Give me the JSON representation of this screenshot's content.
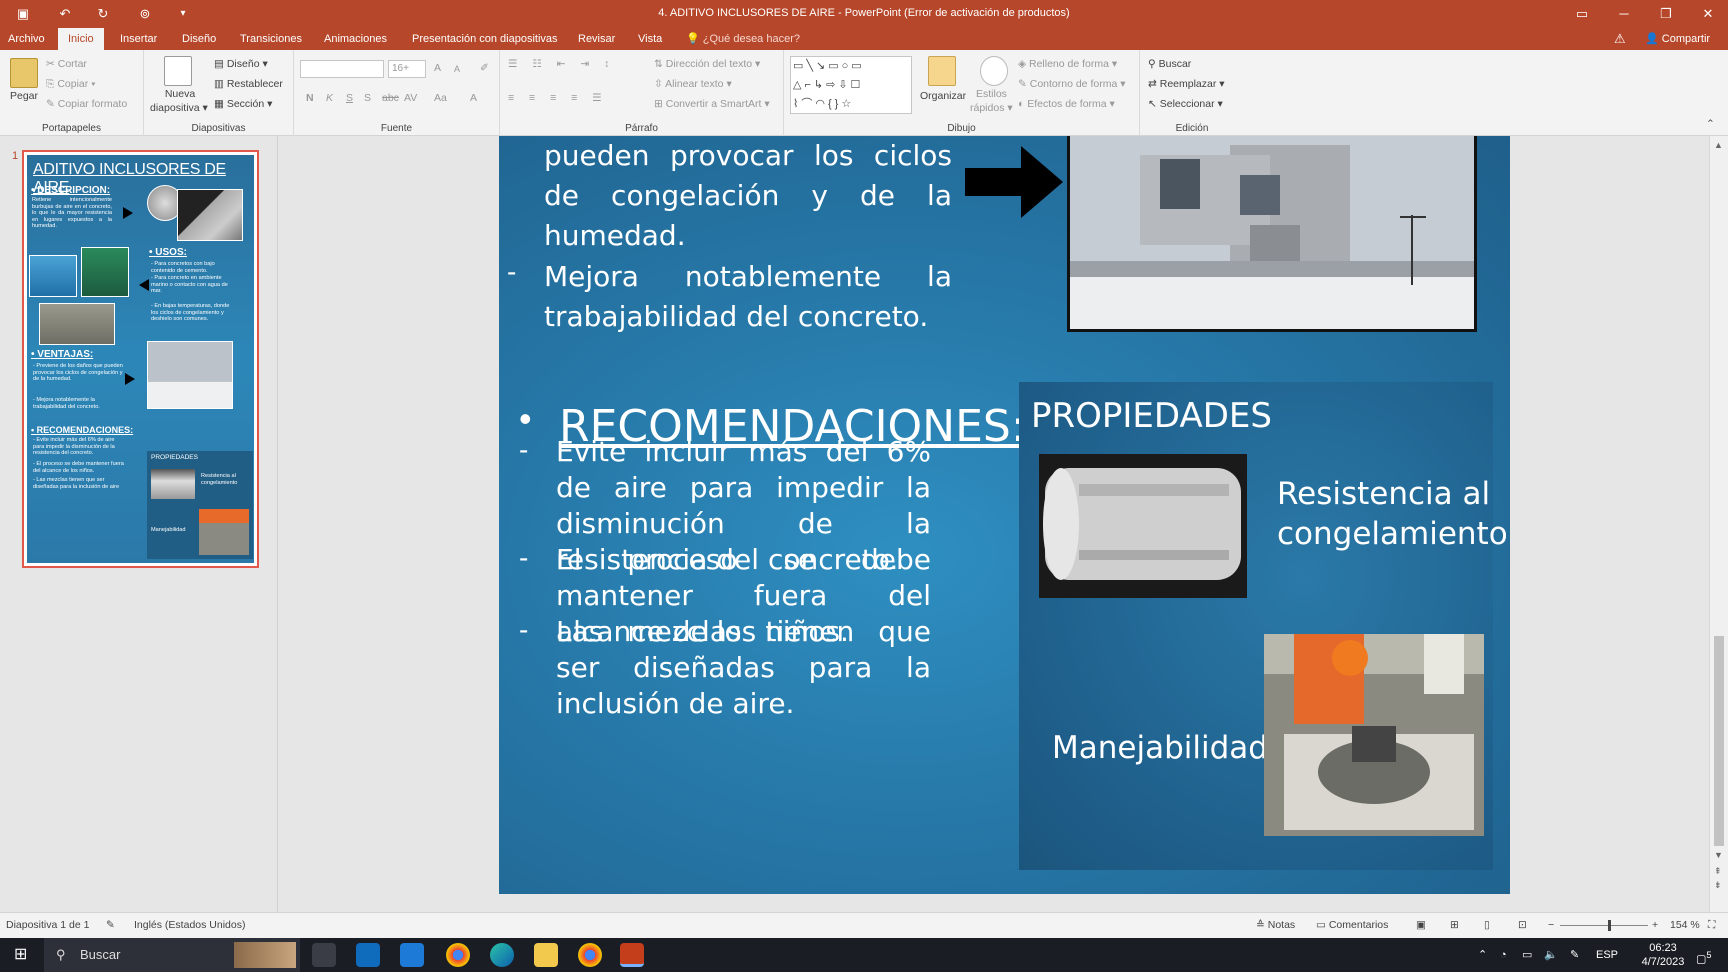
{
  "window": {
    "title": "4. ADITIVO INCLUSORES DE AIRE - PowerPoint (Error de activación de productos)",
    "share_label": "Compartir",
    "tellme_placeholder": "¿Qué desea hacer?"
  },
  "tabs": [
    "Archivo",
    "Inicio",
    "Insertar",
    "Diseño",
    "Transiciones",
    "Animaciones",
    "Presentación con diapositivas",
    "Revisar",
    "Vista"
  ],
  "ribbon": {
    "portapapeles": {
      "label": "Portapapeles",
      "paste": "Pegar",
      "cut": "Cortar",
      "copy": "Copiar",
      "format_painter": "Copiar formato"
    },
    "diapositivas": {
      "label": "Diapositivas",
      "new_slide_1": "Nueva",
      "new_slide_2": "diapositiva",
      "layout": "Diseño",
      "reset": "Restablecer",
      "section": "Sección"
    },
    "fuente": {
      "label": "Fuente",
      "font_size": "16+",
      "bold": "N",
      "italic": "K",
      "underline": "S",
      "shadow": "S",
      "strike": "abc",
      "spacing": "AV",
      "case": "Aa",
      "grow": "A",
      "shrink": "A",
      "color": "A"
    },
    "parrafo": {
      "label": "Párrafo",
      "text_direction": "Dirección del texto",
      "align_text": "Alinear texto",
      "smartart": "Convertir a SmartArt"
    },
    "dibujo": {
      "label": "Dibujo",
      "arrange": "Organizar",
      "styles_1": "Estilos",
      "styles_2": "rápidos",
      "fill": "Relleno de forma",
      "outline": "Contorno de forma",
      "effects": "Efectos de forma"
    },
    "edicion": {
      "label": "Edición",
      "find": "Buscar",
      "replace": "Reemplazar",
      "select": "Seleccionar"
    }
  },
  "thumbnail": {
    "number": "1",
    "title": "ADITIVO INCLUSORES DE AIRE",
    "descripcion_h": "DESCRIPCION:",
    "descripcion": "Retiene intencionalmente burbujas de aire en el concreto, lo que le da mayor resistencia en lugares expuestos a la humedad.",
    "usos_h": "USOS:",
    "usos": [
      "Para concretos con bajo contenido de cemento.",
      "Para concreto en ambiente marino o contacto con agua de mar.",
      "En bajas temperaturas, donde los ciclos de congelamiento y deshielo son comunes."
    ],
    "ventajas_h": "VENTAJAS:",
    "ventajas": [
      "Previene de los daños que pueden provocar los ciclos de congelación y de la humedad.",
      "Mejora notablemente la trabajabilidad del concreto."
    ],
    "reco_h": "RECOMENDACIONES:",
    "reco": [
      "Evite incluir más del 6% de aire para impedir la disminución de la resistencia del concreto.",
      "El proceso se debe mantener fuera del alcance de los niños.",
      "Las mezclas tienen que ser diseñadas para la inclusión de aire"
    ],
    "prop_h": "PROPIEDADES",
    "prop_1": "Resistencia al congelamiento",
    "prop_2": "Manejabilidad"
  },
  "slide": {
    "ventajas_tail_1": "pueden provocar los ciclos de congelación y de la humedad.",
    "ventajas_2": "Mejora notablemente la trabajabilidad del concreto.",
    "reco_title": "RECOMENDACIONES:",
    "reco_1": "Evite incluir más del 6% de aire para impedir la disminución de la resistencia del concreto.",
    "reco_2": "El proceso se debe mantener fuera del alcance de los niños.",
    "reco_3": "Las mezclas tienen que ser diseñadas para la inclusión de aire.",
    "prop_title": "PROPIEDADES",
    "prop_1_line1": "Resistencia al",
    "prop_1_line2": "congelamiento",
    "prop_2": "Manejabilidad"
  },
  "status": {
    "slide_count": "Diapositiva 1 de 1",
    "language": "Inglés (Estados Unidos)",
    "notes": "Notas",
    "comments": "Comentarios",
    "zoom": "154 %"
  },
  "taskbar": {
    "search_placeholder": "Buscar",
    "lang": "ESP",
    "time": "06:23",
    "date": "4/7/2023",
    "notif_count": "5"
  },
  "colors": {
    "accent": "#b7472a",
    "slide_bg": "#2678a8",
    "prop_bg": "#1f5f8b"
  }
}
